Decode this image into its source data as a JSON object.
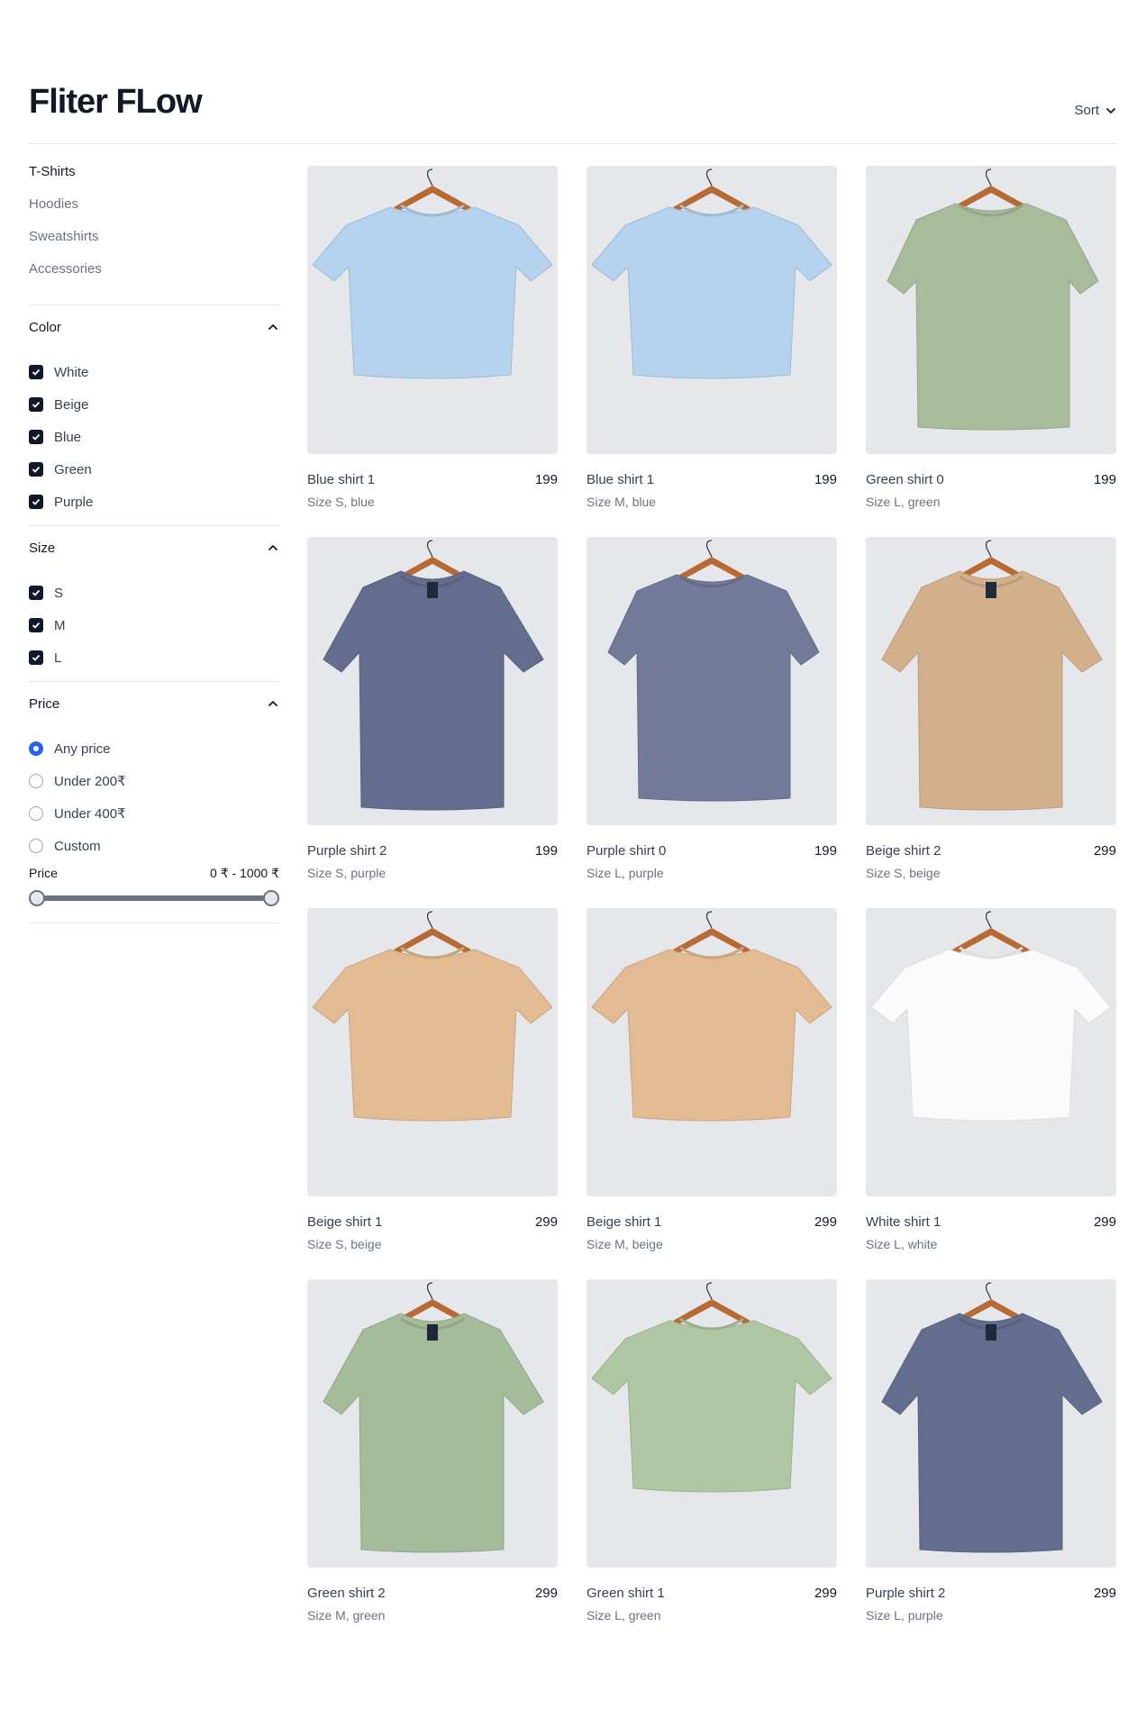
{
  "header": {
    "title": "Fliter FLow",
    "sort_label": "Sort"
  },
  "categories": [
    {
      "label": "T-Shirts",
      "active": true
    },
    {
      "label": "Hoodies",
      "active": false
    },
    {
      "label": "Sweatshirts",
      "active": false
    },
    {
      "label": "Accessories",
      "active": false
    }
  ],
  "filters": {
    "color": {
      "title": "Color",
      "options": [
        "White",
        "Beige",
        "Blue",
        "Green",
        "Purple"
      ]
    },
    "size": {
      "title": "Size",
      "options": [
        "S",
        "M",
        "L"
      ]
    },
    "price": {
      "title": "Price",
      "options": [
        "Any price",
        "Under 200₹",
        "Under 400₹",
        "Custom"
      ],
      "selected": "Any price",
      "range_label": "Price",
      "range_value": "0 ₹ - 1000 ₹"
    }
  },
  "products": [
    {
      "name": "Blue shirt 1",
      "price": "199",
      "desc": "Size S, blue",
      "color": "#b5d3ee",
      "style": "crop"
    },
    {
      "name": "Blue shirt 1",
      "price": "199",
      "desc": "Size M, blue",
      "color": "#b5d3ee",
      "style": "crop"
    },
    {
      "name": "Green shirt 0",
      "price": "199",
      "desc": "Size L, green",
      "color": "#a8bc9c",
      "style": "box"
    },
    {
      "name": "Purple shirt 2",
      "price": "199",
      "desc": "Size S, purple",
      "color": "#636d8e",
      "style": "regular"
    },
    {
      "name": "Purple shirt 0",
      "price": "199",
      "desc": "Size L, purple",
      "color": "#737a99",
      "style": "box"
    },
    {
      "name": "Beige shirt 2",
      "price": "299",
      "desc": "Size S, beige",
      "color": "#d3b08c",
      "style": "regular"
    },
    {
      "name": "Beige shirt 1",
      "price": "299",
      "desc": "Size S, beige",
      "color": "#e3bb92",
      "style": "crop"
    },
    {
      "name": "Beige shirt 1",
      "price": "299",
      "desc": "Size M, beige",
      "color": "#e3bb92",
      "style": "crop"
    },
    {
      "name": "White shirt 1",
      "price": "299",
      "desc": "Size L, white",
      "color": "#fbfbfb",
      "style": "crop"
    },
    {
      "name": "Green shirt 2",
      "price": "299",
      "desc": "Size M, green",
      "color": "#a5bc9b",
      "style": "regular"
    },
    {
      "name": "Green shirt 1",
      "price": "299",
      "desc": "Size L, green",
      "color": "#b0c7a4",
      "style": "crop"
    },
    {
      "name": "Purple shirt 2",
      "price": "299",
      "desc": "Size L, purple",
      "color": "#636d8e",
      "style": "regular"
    }
  ],
  "colors": {
    "accent": "#2563eb",
    "text": "#111827",
    "muted": "#6b7280"
  }
}
